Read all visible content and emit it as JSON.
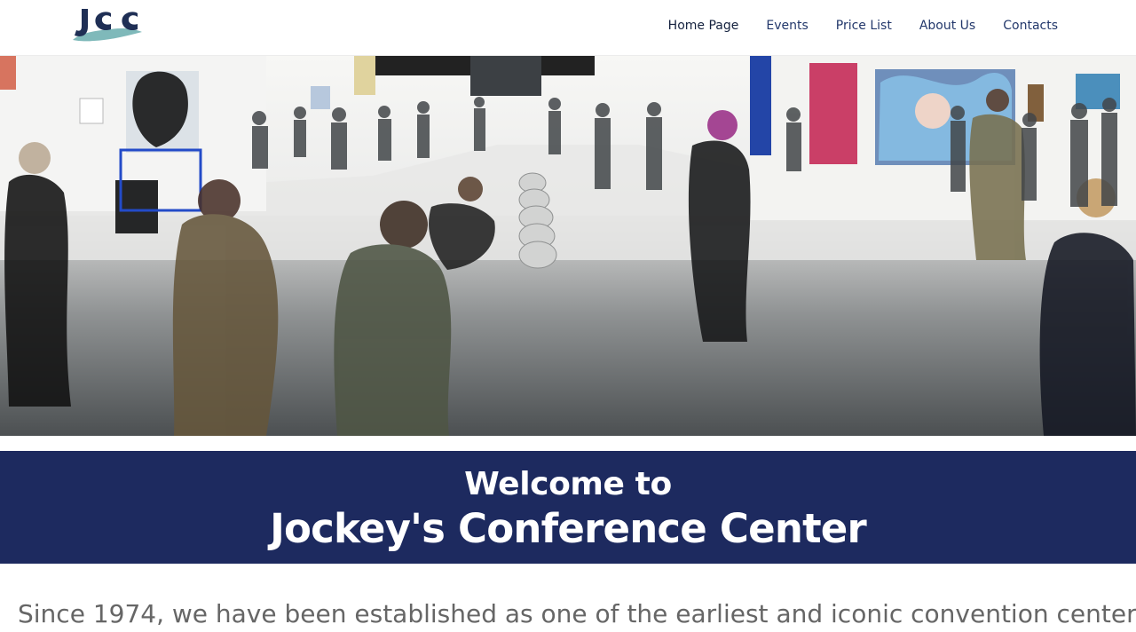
{
  "brand": {
    "logo_text": "JCC",
    "colors": {
      "navy": "#1d2a5f",
      "teal": "#7fb9ba",
      "text_gray": "#666666"
    }
  },
  "nav": {
    "items": [
      {
        "label": "Home Page",
        "active": true
      },
      {
        "label": "Events",
        "active": false
      },
      {
        "label": "Price List",
        "active": false
      },
      {
        "label": "About Us",
        "active": false
      },
      {
        "label": "Contacts",
        "active": false
      }
    ]
  },
  "hero": {
    "image_subject": "art-exhibition-crowd-photo"
  },
  "welcome": {
    "line1": "Welcome to",
    "line2": "Jockey's Conference Center"
  },
  "intro": {
    "text": "Since 1974, we have been established as one of the earliest and iconic convention center"
  }
}
